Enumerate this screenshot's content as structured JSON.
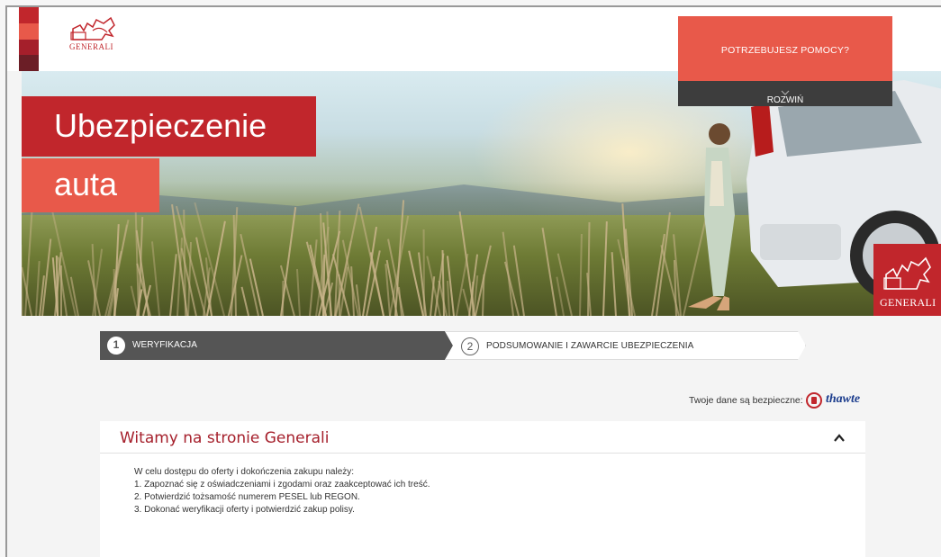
{
  "brand": {
    "name": "GENERALI",
    "red": "#c1262c",
    "coral": "#e8594a",
    "dark": "#3d3d3d"
  },
  "hero": {
    "title_line1": "Ubezpieczenie",
    "title_line2": "auta"
  },
  "help": {
    "label": "POTRZEBUJESZ POMOCY?",
    "expand_label": "ROZWIŃ",
    "expand_icon": "chevron-down-icon"
  },
  "steps": [
    {
      "number": "1",
      "label": "WERYFIKACJA",
      "active": true
    },
    {
      "number": "2",
      "label": "PODSUMOWANIE I ZAWARCIE UBEZPIECZENIA",
      "active": false
    }
  ],
  "security": {
    "text": "Twoje dane są bezpieczne:",
    "badge": "thawte"
  },
  "welcome": {
    "title": "Witamy na stronie Generali",
    "collapse_icon": "chevron-up-icon",
    "lines": [
      "W celu dostępu do oferty i dokończenia zakupu należy:",
      "1. Zapoznać się z oświadczeniami i zgodami oraz zaakceptować ich treść.",
      "2. Potwierdzić tożsamość numerem PESEL lub REGON.",
      "3. Dokonać weryfikacji oferty i potwierdzić zakup polisy."
    ]
  }
}
